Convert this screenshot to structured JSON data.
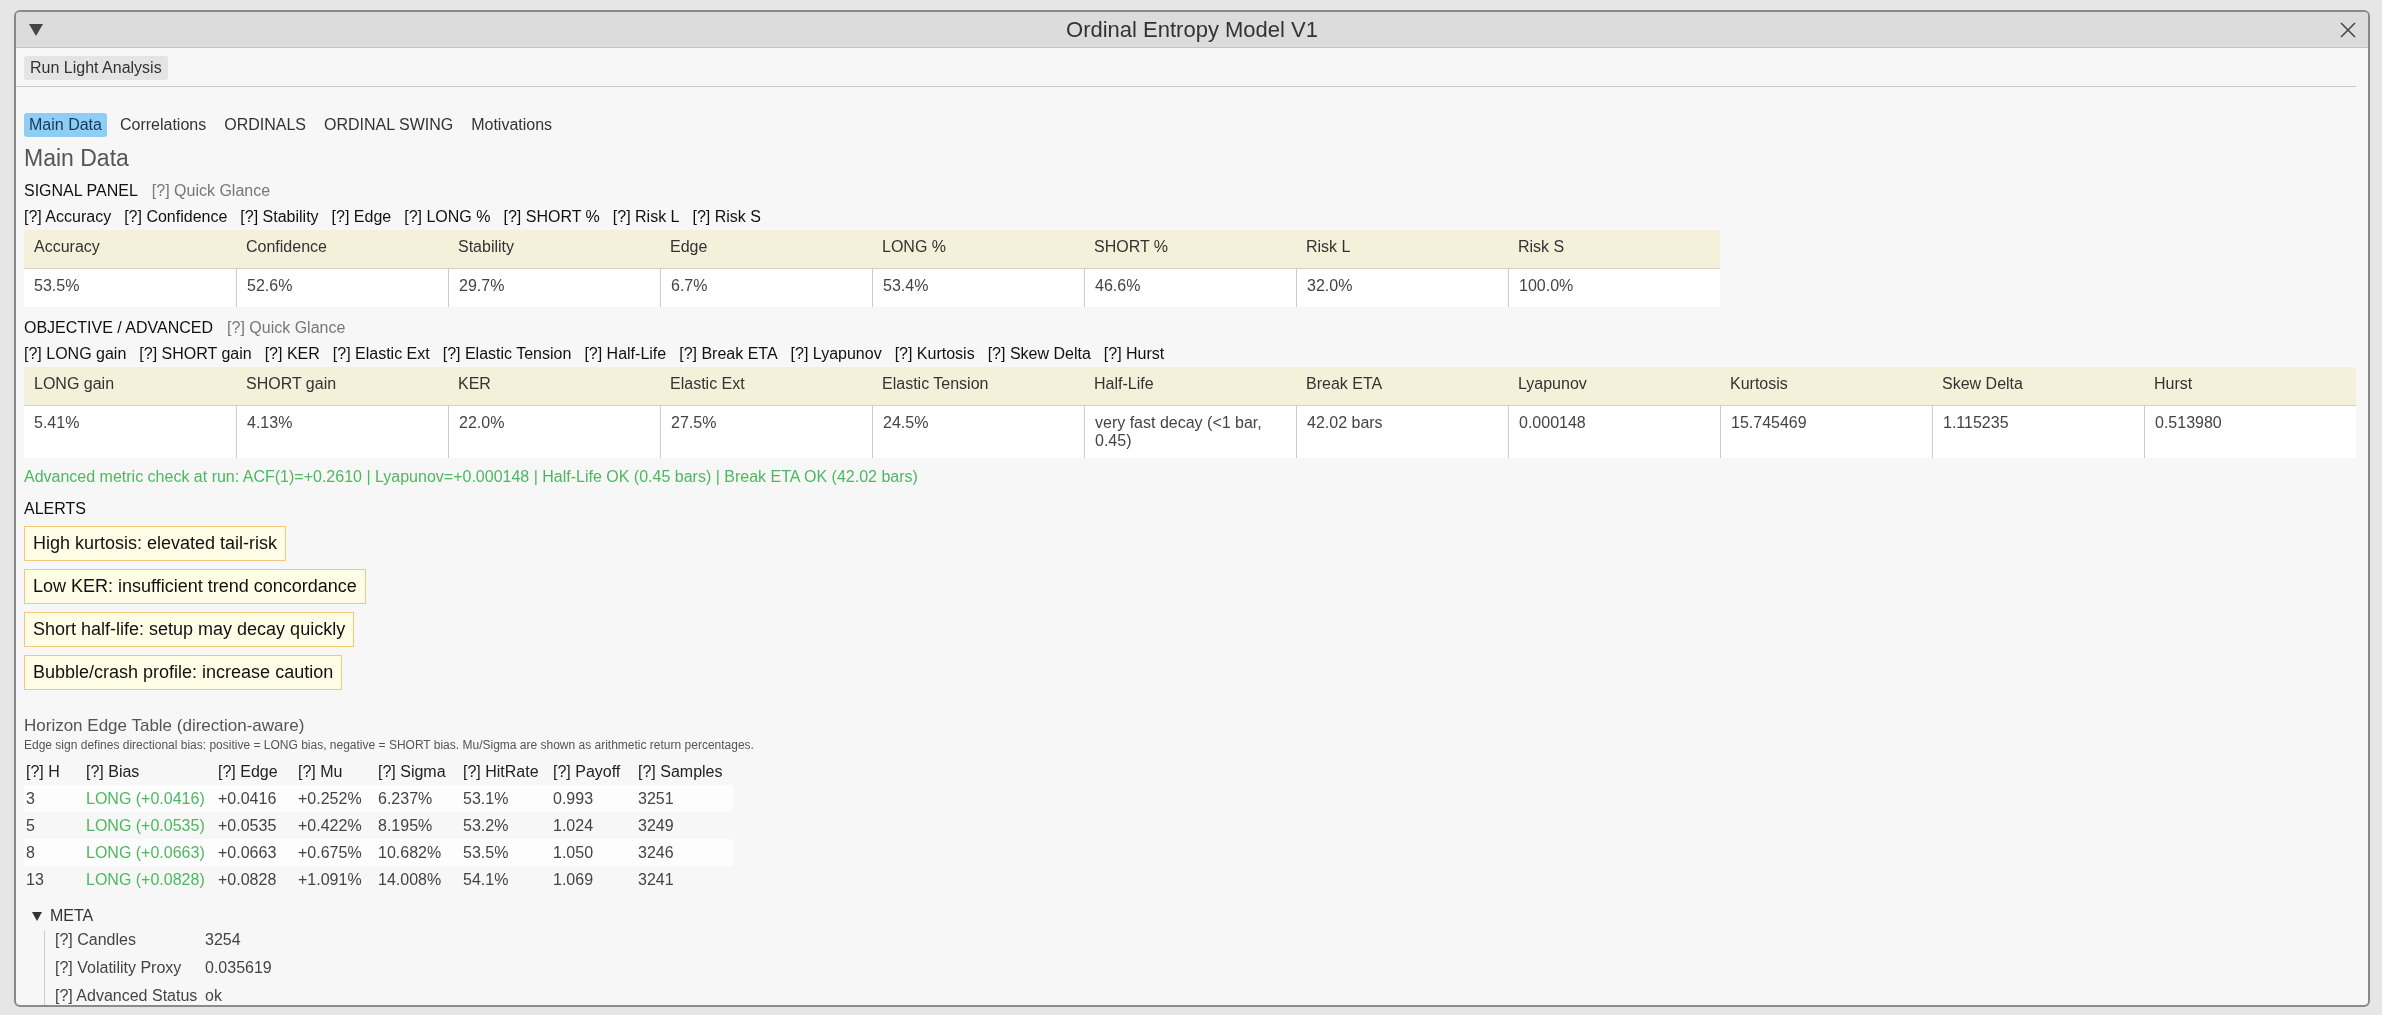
{
  "window": {
    "title": "Ordinal Entropy Model V1"
  },
  "toolbar": {
    "button": "Run Light Analysis"
  },
  "tabs": [
    {
      "label": "Main Data",
      "selected": true
    },
    {
      "label": "Correlations",
      "selected": false
    },
    {
      "label": "ORDINALS",
      "selected": false
    },
    {
      "label": "ORDINAL SWING",
      "selected": false
    },
    {
      "label": "Motivations",
      "selected": false
    }
  ],
  "heading": "Main Data",
  "panels": [
    {
      "title": "SIGNAL PANEL",
      "quick_glance": "[?] Quick Glance",
      "help_items": [
        "[?] Accuracy",
        "[?] Confidence",
        "[?] Stability",
        "[?] Edge",
        "[?] LONG %",
        "[?] SHORT %",
        "[?] Risk L",
        "[?] Risk S"
      ],
      "columns": [
        "Accuracy",
        "Confidence",
        "Stability",
        "Edge",
        "LONG %",
        "SHORT %",
        "Risk L",
        "Risk S"
      ],
      "values": [
        "53.5%",
        "52.6%",
        "29.7%",
        "6.7%",
        "53.4%",
        "46.6%",
        "32.0%",
        "100.0%"
      ]
    },
    {
      "title": "OBJECTIVE / ADVANCED",
      "quick_glance": "[?] Quick Glance",
      "help_items": [
        "[?] LONG gain",
        "[?] SHORT gain",
        "[?] KER",
        "[?] Elastic Ext",
        "[?] Elastic Tension",
        "[?] Half-Life",
        "[?] Break ETA",
        "[?] Lyapunov",
        "[?] Kurtosis",
        "[?] Skew Delta",
        "[?] Hurst"
      ],
      "columns": [
        "LONG gain",
        "SHORT gain",
        "KER",
        "Elastic Ext",
        "Elastic Tension",
        "Half-Life",
        "Break ETA",
        "Lyapunov",
        "Kurtosis",
        "Skew Delta",
        "Hurst"
      ],
      "values": [
        "5.41%",
        "4.13%",
        "22.0%",
        "27.5%",
        "24.5%",
        "very fast decay (<1 bar, 0.45)",
        "42.02 bars",
        "0.000148",
        "15.745469",
        "1.115235",
        "0.513980"
      ]
    }
  ],
  "check_message": "Advanced metric check at run: ACF(1)=+0.2610 | Lyapunov=+0.000148 | Half-Life OK (0.45 bars) | Break ETA OK (42.02 bars)",
  "alerts": {
    "title": "ALERTS",
    "items": [
      "High kurtosis: elevated tail-risk",
      "Low KER: insufficient trend concordance",
      "Short half-life: setup may decay quickly",
      "Bubble/crash profile: increase caution"
    ]
  },
  "horizon": {
    "title": "Horizon Edge Table (direction-aware)",
    "note": "Edge sign defines directional bias: positive = LONG bias, negative = SHORT bias. Mu/Sigma are shown as arithmetic return percentages.",
    "columns": [
      "[?] H",
      "[?] Bias",
      "[?] Edge",
      "[?] Mu",
      "[?] Sigma",
      "[?] HitRate",
      "[?] Payoff",
      "[?] Samples"
    ],
    "rows": [
      [
        "3",
        "LONG (+0.0416)",
        "+0.0416",
        "+0.252%",
        "6.237%",
        "53.1%",
        "0.993",
        "3251"
      ],
      [
        "5",
        "LONG (+0.0535)",
        "+0.0535",
        "+0.422%",
        "8.195%",
        "53.2%",
        "1.024",
        "3249"
      ],
      [
        "8",
        "LONG (+0.0663)",
        "+0.0663",
        "+0.675%",
        "10.682%",
        "53.5%",
        "1.050",
        "3246"
      ],
      [
        "13",
        "LONG (+0.0828)",
        "+0.0828",
        "+1.091%",
        "14.008%",
        "54.1%",
        "1.069",
        "3241"
      ]
    ]
  },
  "meta": {
    "title": "META",
    "expanded": true,
    "items": [
      {
        "label": "[?] Candles",
        "value": "3254"
      },
      {
        "label": "[?] Volatility Proxy",
        "value": "0.035619"
      },
      {
        "label": "[?] Advanced Status",
        "value": "ok"
      }
    ]
  }
}
